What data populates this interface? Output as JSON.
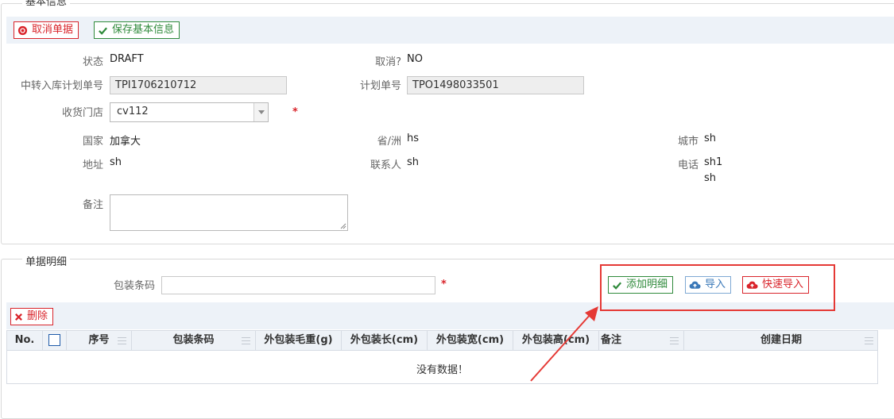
{
  "basic_section": {
    "legend": "基本信息",
    "toolbar": {
      "cancel_label": "取消单据",
      "save_label": "保存基本信息"
    },
    "fields": {
      "status_label": "状态",
      "status_value": "DRAFT",
      "cancelled_label": "取消?",
      "cancelled_value": "NO",
      "transfer_plan_label": "中转入库计划单号",
      "transfer_plan_value": "TPI1706210712",
      "plan_no_label": "计划单号",
      "plan_no_value": "TPO1498033501",
      "store_label": "收货门店",
      "store_value": "cv112",
      "required_mark": "*",
      "country_label": "国家",
      "country_value": "加拿大",
      "province_label": "省/洲",
      "province_value": "hs",
      "city_label": "城市",
      "city_value": "sh",
      "address_label": "地址",
      "address_value": "sh",
      "contact_label": "联系人",
      "contact_value": "sh",
      "phone_label": "电话",
      "phone_value_line1": "sh1",
      "phone_value_line2": "sh",
      "remark_label": "备注"
    }
  },
  "detail_section": {
    "legend": "单据明细",
    "barcode_label": "包装条码",
    "barcode_value": "",
    "required_mark": "*",
    "buttons": {
      "add_detail": "添加明细",
      "import": "导入",
      "quick_import": "快速导入",
      "delete": "删除"
    },
    "grid": {
      "columns": [
        "No.",
        "",
        "序号",
        "包装条码",
        "外包装毛重(g)",
        "外包装长(cm)",
        "外包装宽(cm)",
        "外包装高(cm)",
        "备注",
        "创建日期"
      ],
      "empty_text": "没有数据！"
    }
  },
  "colors": {
    "danger": "#d9242b",
    "success": "#2f8a3b",
    "info": "#3a78b8",
    "toolbar_bg": "#edf2f8",
    "annotation": "#e53935"
  }
}
